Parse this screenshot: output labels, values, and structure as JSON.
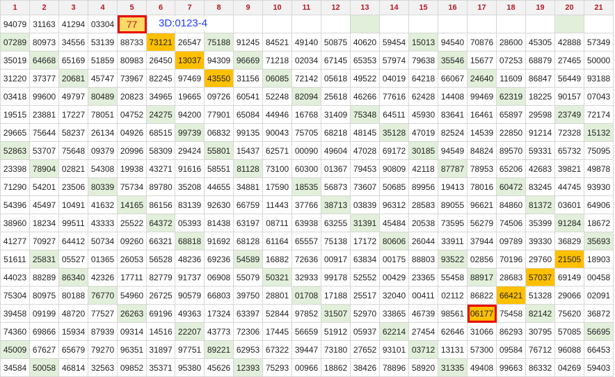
{
  "columns": [
    "1",
    "2",
    "3",
    "4",
    "5",
    "6",
    "7",
    "8",
    "9",
    "10",
    "11",
    "12",
    "13",
    "14",
    "15",
    "16",
    "17",
    "18",
    "19",
    "20",
    "21"
  ],
  "first_row": {
    "cells": [
      "94079",
      "31163",
      "41294",
      "03304",
      "77",
      "",
      "",
      "",
      "",
      "",
      "",
      "",
      "",
      "",
      "",
      "",
      "",
      "",
      "",
      "",
      ""
    ],
    "note": "3D:0123-4"
  },
  "rows": [
    [
      "07289",
      "80973",
      "34556",
      "53139",
      "88733",
      "73121",
      "26547",
      "75188",
      "91245",
      "84521",
      "49140",
      "50875",
      "40620",
      "59454",
      "15013",
      "94540",
      "70876",
      "28600",
      "45305",
      "42888",
      "57349"
    ],
    [
      "35019",
      "64668",
      "65169",
      "51859",
      "80983",
      "26450",
      "13037",
      "94309",
      "96669",
      "71218",
      "02034",
      "67145",
      "65353",
      "57974",
      "79638",
      "35546",
      "15677",
      "07253",
      "68879",
      "27465",
      "50000"
    ],
    [
      "31220",
      "37377",
      "20681",
      "45747",
      "73967",
      "82245",
      "97469",
      "43550",
      "31156",
      "06085",
      "72142",
      "05618",
      "49522",
      "04019",
      "64218",
      "66067",
      "24640",
      "11609",
      "86847",
      "56449",
      "93188"
    ],
    [
      "03418",
      "99600",
      "49797",
      "80489",
      "20823",
      "34965",
      "19665",
      "09726",
      "60541",
      "52248",
      "82094",
      "25618",
      "46266",
      "77616",
      "62428",
      "14408",
      "99469",
      "62319",
      "18225",
      "90157",
      "07043"
    ],
    [
      "19515",
      "23881",
      "17227",
      "78051",
      "04752",
      "24275",
      "94200",
      "77901",
      "65084",
      "44946",
      "16768",
      "31409",
      "75348",
      "64511",
      "45930",
      "83641",
      "16461",
      "65897",
      "29598",
      "23749",
      "72174"
    ],
    [
      "29665",
      "75644",
      "58237",
      "26134",
      "04926",
      "68515",
      "99739",
      "06832",
      "99135",
      "90043",
      "75705",
      "68218",
      "48145",
      "35128",
      "47019",
      "82524",
      "14539",
      "22850",
      "91214",
      "72328",
      "15132"
    ],
    [
      "52863",
      "53707",
      "75648",
      "09379",
      "20996",
      "58309",
      "29424",
      "55801",
      "15437",
      "62571",
      "00090",
      "49604",
      "47028",
      "69172",
      "30185",
      "94549",
      "84824",
      "89570",
      "59331",
      "65732",
      "75095"
    ],
    [
      "23398",
      "78904",
      "02821",
      "54308",
      "19938",
      "43271",
      "91616",
      "58551",
      "81128",
      "73100",
      "60300",
      "01367",
      "79453",
      "90809",
      "42118",
      "87787",
      "78953",
      "65206",
      "42683",
      "39821",
      "49878"
    ],
    [
      "71290",
      "54201",
      "23506",
      "80339",
      "75734",
      "89780",
      "35208",
      "44655",
      "34881",
      "17590",
      "18535",
      "56873",
      "73607",
      "50685",
      "89956",
      "19413",
      "78016",
      "60472",
      "83245",
      "44745",
      "93930"
    ],
    [
      "54396",
      "45497",
      "10491",
      "41632",
      "14165",
      "86156",
      "83139",
      "92630",
      "66759",
      "11443",
      "37766",
      "38713",
      "03839",
      "96312",
      "28583",
      "89055",
      "96621",
      "84860",
      "81372",
      "03601",
      "64906"
    ],
    [
      "38960",
      "18234",
      "99511",
      "43333",
      "25522",
      "64372",
      "05393",
      "81438",
      "63197",
      "08711",
      "63938",
      "63255",
      "31391",
      "45484",
      "20538",
      "73595",
      "56279",
      "74506",
      "35399",
      "91284",
      "18672"
    ],
    [
      "41277",
      "70927",
      "64412",
      "50734",
      "09260",
      "66321",
      "68818",
      "91692",
      "68128",
      "61164",
      "65557",
      "75138",
      "17172",
      "80606",
      "26044",
      "33911",
      "37944",
      "09789",
      "39330",
      "36829",
      "35693"
    ],
    [
      "51611",
      "25831",
      "05527",
      "01365",
      "26053",
      "56528",
      "48236",
      "69236",
      "54589",
      "16882",
      "72636",
      "00917",
      "63834",
      "00175",
      "88803",
      "93522",
      "02856",
      "70196",
      "29760",
      "21505",
      "18903"
    ],
    [
      "44023",
      "88289",
      "86340",
      "42326",
      "17711",
      "82779",
      "91737",
      "06908",
      "55079",
      "50321",
      "32933",
      "99178",
      "52552",
      "00429",
      "23365",
      "55458",
      "88917",
      "28683",
      "57037",
      "69149",
      "00458"
    ],
    [
      "75304",
      "80975",
      "80188",
      "76770",
      "54960",
      "26725",
      "90579",
      "66803",
      "39750",
      "28801",
      "01708",
      "17188",
      "25517",
      "32040",
      "00411",
      "02112",
      "86822",
      "66421",
      "51328",
      "29066",
      "02091"
    ],
    [
      "39458",
      "09199",
      "48720",
      "77527",
      "26263",
      "69196",
      "49363",
      "17324",
      "63397",
      "52844",
      "97852",
      "31507",
      "52970",
      "33865",
      "46739",
      "98561",
      "06177",
      "75458",
      "82142",
      "75620",
      "36872"
    ],
    [
      "74360",
      "69866",
      "15934",
      "87939",
      "09314",
      "14516",
      "22207",
      "43773",
      "72306",
      "17445",
      "56659",
      "51912",
      "05937",
      "62214",
      "27454",
      "62646",
      "31066",
      "86293",
      "30795",
      "57085",
      "56695"
    ],
    [
      "45009",
      "67627",
      "65679",
      "79270",
      "96351",
      "31897",
      "97751",
      "89221",
      "62953",
      "67322",
      "39447",
      "73180",
      "27652",
      "93101",
      "03712",
      "13131",
      "57300",
      "09584",
      "76712",
      "96088",
      "66453"
    ],
    [
      "34584",
      "50058",
      "46814",
      "32563",
      "09852",
      "35371",
      "95380",
      "45626",
      "12393",
      "75293",
      "00966",
      "18862",
      "38426",
      "78896",
      "58920",
      "31335",
      "49408",
      "99663",
      "86332",
      "04269",
      "59403"
    ]
  ],
  "highlights": {
    "green": [
      [
        0,
        0
      ],
      [
        0,
        7
      ],
      [
        0,
        14
      ],
      [
        1,
        1
      ],
      [
        1,
        8
      ],
      [
        1,
        15
      ],
      [
        2,
        2
      ],
      [
        2,
        9
      ],
      [
        2,
        16
      ],
      [
        3,
        3
      ],
      [
        3,
        10
      ],
      [
        3,
        17
      ],
      [
        4,
        5
      ],
      [
        4,
        12
      ],
      [
        4,
        19
      ],
      [
        5,
        6
      ],
      [
        5,
        13
      ],
      [
        5,
        20
      ],
      [
        6,
        0
      ],
      [
        6,
        7
      ],
      [
        6,
        14
      ],
      [
        7,
        1
      ],
      [
        7,
        8
      ],
      [
        7,
        15
      ],
      [
        8,
        3
      ],
      [
        8,
        10
      ],
      [
        8,
        17
      ],
      [
        9,
        4
      ],
      [
        9,
        11
      ],
      [
        9,
        18
      ],
      [
        10,
        5
      ],
      [
        10,
        12
      ],
      [
        10,
        19
      ],
      [
        11,
        6
      ],
      [
        11,
        13
      ],
      [
        11,
        20
      ],
      [
        12,
        1
      ],
      [
        12,
        8
      ],
      [
        12,
        15
      ],
      [
        13,
        2
      ],
      [
        13,
        9
      ],
      [
        13,
        16
      ],
      [
        14,
        3
      ],
      [
        14,
        10
      ],
      [
        15,
        4
      ],
      [
        15,
        11
      ],
      [
        15,
        18
      ],
      [
        16,
        6
      ],
      [
        16,
        13
      ],
      [
        16,
        20
      ],
      [
        17,
        0
      ],
      [
        17,
        7
      ],
      [
        17,
        14
      ],
      [
        18,
        1
      ],
      [
        18,
        8
      ],
      [
        18,
        15
      ]
    ],
    "orange": [
      [
        0,
        5
      ],
      [
        1,
        6
      ],
      [
        2,
        7
      ],
      [
        12,
        19
      ],
      [
        13,
        18
      ],
      [
        14,
        17
      ],
      [
        15,
        16
      ]
    ],
    "boxed": [
      [
        15,
        16
      ]
    ]
  }
}
